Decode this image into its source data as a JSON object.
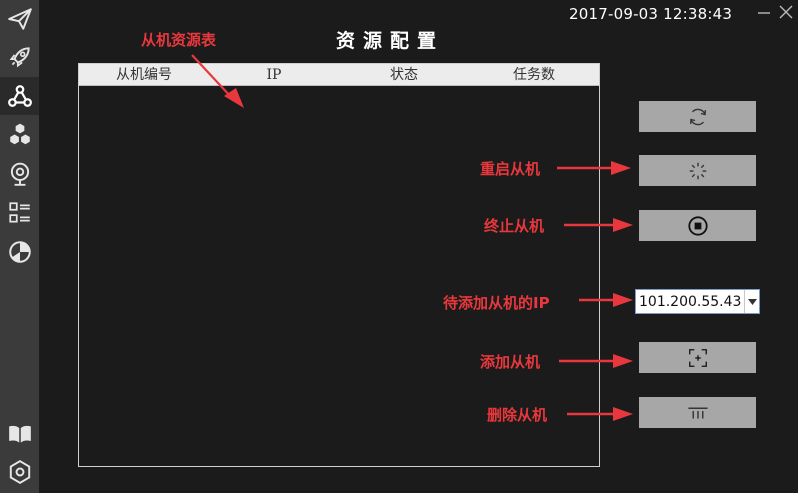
{
  "header": {
    "datetime": "2017-09-03   12:38:43",
    "title": "资源配置"
  },
  "sidebar": {
    "items": [
      {
        "icon": "paper-plane-icon"
      },
      {
        "icon": "rocket-icon"
      },
      {
        "icon": "webhook-icon",
        "active": true
      },
      {
        "icon": "hexagons-icon"
      },
      {
        "icon": "webcam-icon"
      },
      {
        "icon": "list-grid-icon"
      },
      {
        "icon": "pie-chart-icon"
      },
      {
        "icon": "book-icon"
      },
      {
        "icon": "hexagon-settings-icon"
      }
    ]
  },
  "table": {
    "columns": [
      "从机编号",
      "IP",
      "状态",
      "任务数"
    ],
    "rows": []
  },
  "annotations": {
    "table_label": "从机资源表",
    "restart": "重启从机",
    "terminate": "终止从机",
    "pending_ip": "待添加从机的IP",
    "add": "添加从机",
    "delete": "删除从机"
  },
  "ip_select": {
    "value": "101.200.55.43"
  },
  "colors": {
    "background": "#1b1b1b",
    "sidebar": "#3b3b3b",
    "button": "#a7a7a7",
    "annotation": "#e8383d"
  }
}
